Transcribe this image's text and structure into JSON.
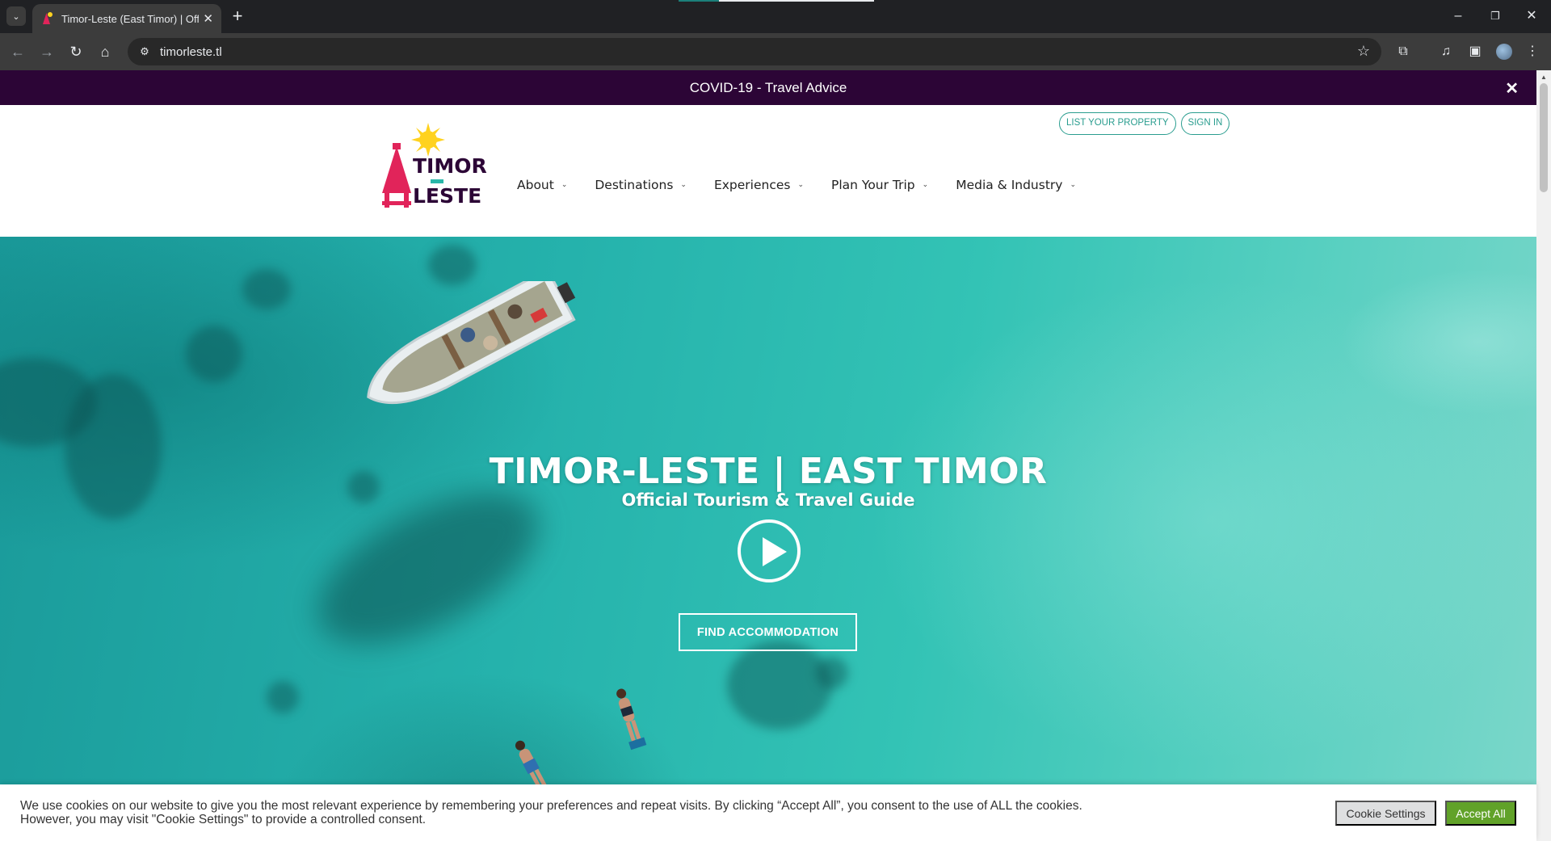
{
  "browser": {
    "tab_title": "Timor-Leste (East Timor) | Offi",
    "url": "timorleste.tl",
    "icons": [
      "tab-search-icon",
      "close-icon",
      "plus-icon",
      "back-icon",
      "forward-icon",
      "reload-icon",
      "home-icon",
      "site-info-icon",
      "star-icon",
      "extensions-icon",
      "media-icon",
      "side-panel-icon",
      "avatar",
      "menu-icon",
      "minimize-icon",
      "restore-icon",
      "close-window-icon"
    ]
  },
  "banner": {
    "text": "COVID-19 - Travel Advice",
    "close_glyph": "✕",
    "color": "#2c0536"
  },
  "header": {
    "logo": {
      "line1": "TIMOR",
      "line2": "LESTE"
    },
    "top_links": {
      "list_property": "LIST YOUR PROPERTY",
      "sign_in": "SIGN IN"
    },
    "nav": [
      {
        "label": "About"
      },
      {
        "label": "Destinations"
      },
      {
        "label": "Experiences"
      },
      {
        "label": "Plan Your Trip"
      },
      {
        "label": "Media & Industry"
      }
    ],
    "accent_color": "#2a9d8f"
  },
  "hero": {
    "title": "TIMOR-LESTE | EAST TIMOR",
    "subtitle": "Official Tourism & Travel Guide",
    "cta": "FIND ACCOMMODATION"
  },
  "cookie": {
    "text": "We use cookies on our website to give you the most relevant experience by remembering your preferences and repeat visits. By clicking “Accept All”, you consent to the use of ALL the cookies. However, you may visit \"Cookie Settings\" to provide a controlled consent.",
    "settings_label": "Cookie Settings",
    "accept_label": "Accept All",
    "accept_color": "#61a229"
  }
}
